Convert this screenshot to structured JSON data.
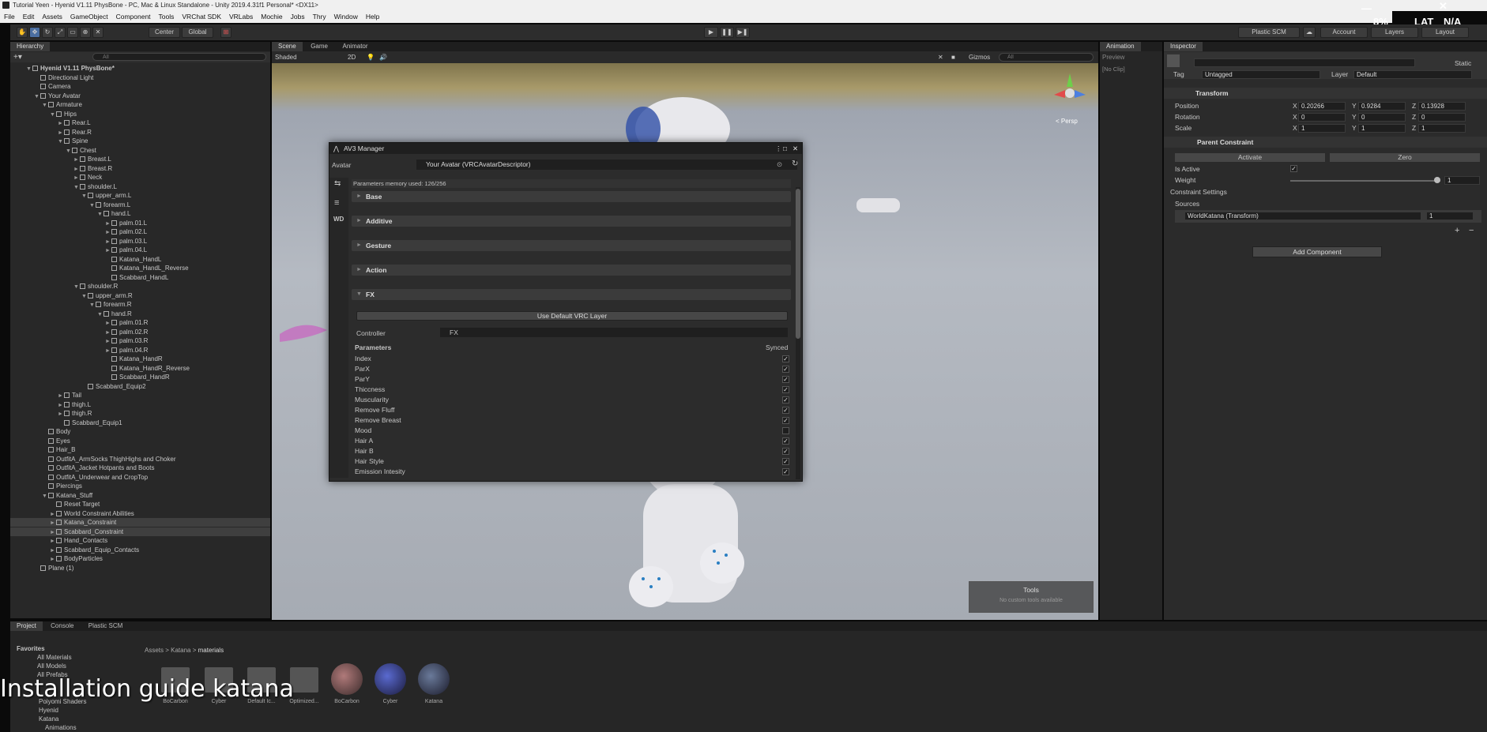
{
  "window": {
    "title": "Tutorial Yeen - Hyenid V1.11 PhysBone - PC, Mac & Linux Standalone - Unity 2019.4.31f1 Personal* <DX11>"
  },
  "menu": [
    "File",
    "Edit",
    "Assets",
    "GameObject",
    "Component",
    "Tools",
    "VRChat SDK",
    "VRLabs",
    "Mochie",
    "Jobs",
    "Thry",
    "Window",
    "Help"
  ],
  "sys": {
    "percent": "8%",
    "lang": "LAT",
    "status": "N/A"
  },
  "toolbar": {
    "pivot": "Center",
    "space": "Global",
    "plastic": "Plastic SCM",
    "account": "Account",
    "layers": "Layers",
    "layout": "Layout"
  },
  "hierarchy": {
    "tab": "Hierarchy",
    "search_placeholder": "All",
    "items": [
      {
        "label": "Hyenid V1.11 PhysBone*",
        "indent": 0,
        "arrow": "▼",
        "bold": true
      },
      {
        "label": "Directional Light",
        "indent": 1,
        "arrow": ""
      },
      {
        "label": "Camera",
        "indent": 1,
        "arrow": ""
      },
      {
        "label": "Your Avatar",
        "indent": 1,
        "arrow": "▼"
      },
      {
        "label": "Armature",
        "indent": 2,
        "arrow": "▼"
      },
      {
        "label": "Hips",
        "indent": 3,
        "arrow": "▼"
      },
      {
        "label": "Rear.L",
        "indent": 4,
        "arrow": "►"
      },
      {
        "label": "Rear.R",
        "indent": 4,
        "arrow": "►"
      },
      {
        "label": "Spine",
        "indent": 4,
        "arrow": "▼"
      },
      {
        "label": "Chest",
        "indent": 5,
        "arrow": "▼"
      },
      {
        "label": "Breast.L",
        "indent": 6,
        "arrow": "►"
      },
      {
        "label": "Breast.R",
        "indent": 6,
        "arrow": "►"
      },
      {
        "label": "Neck",
        "indent": 6,
        "arrow": "►"
      },
      {
        "label": "shoulder.L",
        "indent": 6,
        "arrow": "▼"
      },
      {
        "label": "upper_arm.L",
        "indent": 7,
        "arrow": "▼"
      },
      {
        "label": "forearm.L",
        "indent": 8,
        "arrow": "▼"
      },
      {
        "label": "hand.L",
        "indent": 9,
        "arrow": "▼"
      },
      {
        "label": "palm.01.L",
        "indent": 10,
        "arrow": "►"
      },
      {
        "label": "palm.02.L",
        "indent": 10,
        "arrow": "►"
      },
      {
        "label": "palm.03.L",
        "indent": 10,
        "arrow": "►"
      },
      {
        "label": "palm.04.L",
        "indent": 10,
        "arrow": "►"
      },
      {
        "label": "Katana_HandL",
        "indent": 10,
        "arrow": ""
      },
      {
        "label": "Katana_HandL_Reverse",
        "indent": 10,
        "arrow": ""
      },
      {
        "label": "Scabbard_HandL",
        "indent": 10,
        "arrow": ""
      },
      {
        "label": "shoulder.R",
        "indent": 6,
        "arrow": "▼"
      },
      {
        "label": "upper_arm.R",
        "indent": 7,
        "arrow": "▼"
      },
      {
        "label": "forearm.R",
        "indent": 8,
        "arrow": "▼"
      },
      {
        "label": "hand.R",
        "indent": 9,
        "arrow": "▼"
      },
      {
        "label": "palm.01.R",
        "indent": 10,
        "arrow": "►"
      },
      {
        "label": "palm.02.R",
        "indent": 10,
        "arrow": "►"
      },
      {
        "label": "palm.03.R",
        "indent": 10,
        "arrow": "►"
      },
      {
        "label": "palm.04.R",
        "indent": 10,
        "arrow": "►"
      },
      {
        "label": "Katana_HandR",
        "indent": 10,
        "arrow": ""
      },
      {
        "label": "Katana_HandR_Reverse",
        "indent": 10,
        "arrow": ""
      },
      {
        "label": "Scabbard_HandR",
        "indent": 10,
        "arrow": ""
      },
      {
        "label": "Scabbard_Equip2",
        "indent": 7,
        "arrow": ""
      },
      {
        "label": "Tail",
        "indent": 4,
        "arrow": "►"
      },
      {
        "label": "thigh.L",
        "indent": 4,
        "arrow": "►"
      },
      {
        "label": "thigh.R",
        "indent": 4,
        "arrow": "►"
      },
      {
        "label": "Scabbard_Equip1",
        "indent": 4,
        "arrow": ""
      },
      {
        "label": "Body",
        "indent": 2,
        "arrow": ""
      },
      {
        "label": "Eyes",
        "indent": 2,
        "arrow": ""
      },
      {
        "label": "Hair_B",
        "indent": 2,
        "arrow": ""
      },
      {
        "label": "OutfitA_ArmSocks ThighHighs and Choker",
        "indent": 2,
        "arrow": ""
      },
      {
        "label": "OutfitA_Jacket Hotpants and Boots",
        "indent": 2,
        "arrow": ""
      },
      {
        "label": "OutfitA_Underwear and CropTop",
        "indent": 2,
        "arrow": ""
      },
      {
        "label": "Piercings",
        "indent": 2,
        "arrow": ""
      },
      {
        "label": "Katana_Stuff",
        "indent": 2,
        "arrow": "▼"
      },
      {
        "label": "Reset Target",
        "indent": 3,
        "arrow": ""
      },
      {
        "label": "World Constraint Abilities",
        "indent": 3,
        "arrow": "►"
      },
      {
        "label": "Katana_Constraint",
        "indent": 3,
        "arrow": "►",
        "sel": true
      },
      {
        "label": "Scabbard_Constraint",
        "indent": 3,
        "arrow": "►",
        "sel": true
      },
      {
        "label": "Hand_Contacts",
        "indent": 3,
        "arrow": "►"
      },
      {
        "label": "Scabbard_Equip_Contacts",
        "indent": 3,
        "arrow": "►"
      },
      {
        "label": "BodyParticles",
        "indent": 3,
        "arrow": "►"
      },
      {
        "label": "Plane (1)",
        "indent": 1,
        "arrow": ""
      }
    ]
  },
  "scene": {
    "tabs": [
      "Scene",
      "Game",
      "Animator"
    ],
    "shading": "Shaded",
    "mode": "2D",
    "gizmos": "Gizmos",
    "search_placeholder": "All",
    "persp": "< Persp",
    "tools_title": "Tools",
    "tools_sub": "No custom tools available"
  },
  "av3": {
    "title": "AV3 Manager",
    "avatar_label": "Avatar",
    "avatar_value": "Your Avatar (VRCAvatarDescriptor)",
    "memory": "Parameters memory used: 126/256",
    "wd_label": "WD",
    "sections": [
      "Base",
      "Additive",
      "Gesture",
      "Action",
      "FX"
    ],
    "use_default": "Use Default VRC Layer",
    "controller_label": "Controller",
    "controller_value": "FX",
    "params_header": "Parameters",
    "synced_header": "Synced",
    "params": [
      {
        "name": "Index",
        "synced": true
      },
      {
        "name": "ParX",
        "synced": true
      },
      {
        "name": "ParY",
        "synced": true
      },
      {
        "name": "Thiccness",
        "synced": true
      },
      {
        "name": "Muscularity",
        "synced": true
      },
      {
        "name": "Remove Fluff",
        "synced": true
      },
      {
        "name": "Remove Breast",
        "synced": true
      },
      {
        "name": "Mood",
        "synced": false
      },
      {
        "name": "Hair A",
        "synced": true
      },
      {
        "name": "Hair B",
        "synced": true
      },
      {
        "name": "Hair Style",
        "synced": true
      },
      {
        "name": "Emission Intesity",
        "synced": true
      }
    ]
  },
  "animation": {
    "tab": "Animation",
    "preview": "Preview",
    "clip": "[No Clip]"
  },
  "inspector": {
    "tab": "Inspector",
    "static": "Static",
    "tag_label": "Tag",
    "tag_value": "Untagged",
    "layer_label": "Layer",
    "layer_value": "Default",
    "transform_title": "Transform",
    "position_label": "Position",
    "pos": {
      "x": "0.20266",
      "y": "0.9284",
      "z": "0.13928"
    },
    "rotation_label": "Rotation",
    "rot": {
      "x": "0",
      "y": "0",
      "z": "0"
    },
    "scale_label": "Scale",
    "scl": {
      "x": "1",
      "y": "1",
      "z": "1"
    },
    "constraint_title": "Parent Constraint",
    "activate": "Activate",
    "zero": "Zero",
    "is_active": "Is Active",
    "weight": "Weight",
    "weight_value": "1",
    "constraint_settings": "Constraint Settings",
    "sources": "Sources",
    "source_item": "WorldKatana (Transform)",
    "source_weight": "1",
    "add_component": "Add Component"
  },
  "project": {
    "tabs": [
      "Project",
      "Console",
      "Plastic SCM"
    ],
    "favorites": "Favorites",
    "fav_items": [
      "All Materials",
      "All Models",
      "All Prefabs"
    ],
    "tree": [
      "Poiyomi Shaders",
      "Hyenid",
      "Katana",
      "Animations"
    ],
    "breadcrumb": [
      "Assets",
      "Katana",
      "materials"
    ],
    "assets": [
      "BoCarbon",
      "Cyber",
      "Default Ic...",
      "Optimized...",
      "BoCarbon",
      "Cyber",
      "Katana"
    ]
  },
  "caption": "Installation guide katana"
}
